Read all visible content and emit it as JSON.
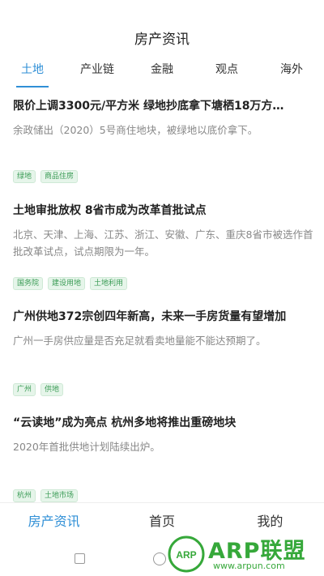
{
  "header": {
    "title": "房产资讯"
  },
  "tabs": [
    {
      "label": "土地",
      "active": true
    },
    {
      "label": "产业链",
      "active": false
    },
    {
      "label": "金融",
      "active": false
    },
    {
      "label": "观点",
      "active": false
    },
    {
      "label": "海外",
      "active": false
    }
  ],
  "articles": [
    {
      "title": "限价上调3300元/平方米 绿地抄底拿下塘栖18万方…",
      "summary": "余政储出（2020）5号商住地块，被绿地以底价拿下。",
      "tags": [
        "绿地",
        "商品住房"
      ]
    },
    {
      "title": "土地审批放权 8省市成为改革首批试点",
      "summary": "北京、天津、上海、江苏、浙江、安徽、广东、重庆8省市被选作首批改革试点，试点期限为一年。",
      "tags": [
        "国务院",
        "建设用地",
        "土地利用"
      ]
    },
    {
      "title": "广州供地372宗创四年新高，未来一手房货量有望增加",
      "summary": "广州一手房供应量是否充足就看卖地量能不能达预期了。",
      "tags": [
        "广州",
        "供地"
      ]
    },
    {
      "title": "“云读地”成为亮点 杭州多地将推出重磅地块",
      "summary": "2020年首批供地计划陆续出炉。",
      "tags": [
        "杭州",
        "土地市场"
      ]
    }
  ],
  "bottom_nav": [
    {
      "label": "房产资讯",
      "active": true
    },
    {
      "label": "首页",
      "active": false
    },
    {
      "label": "我的",
      "active": false
    }
  ],
  "watermark": {
    "brand": "ARP联盟",
    "url": "www.arpun.com",
    "badge": "ARP"
  },
  "colors": {
    "accent": "#2f8fd6",
    "tag_green": "#3a9b55",
    "watermark_green": "#36a83a"
  },
  "icons": {
    "sys_back": "square-icon",
    "sys_home": "circle-icon"
  }
}
